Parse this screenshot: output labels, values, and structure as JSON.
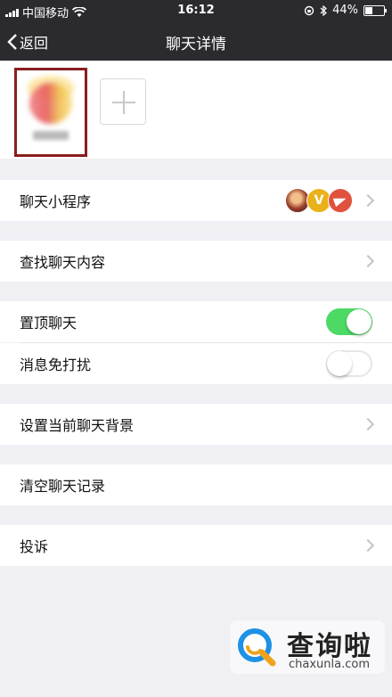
{
  "status_bar": {
    "carrier": "中国移动",
    "time": "16:12",
    "battery": "44%",
    "battery_level": 0.44
  },
  "nav": {
    "back_label": "返回",
    "title": "聊天详情"
  },
  "settings": {
    "mini_programs": "聊天小程序",
    "mini_badge_v": "V",
    "search_chat": "查找聊天内容",
    "sticky_chat": "置顶聊天",
    "sticky_on": true,
    "do_not_disturb": "消息免打扰",
    "dnd_on": false,
    "set_background": "设置当前聊天背景",
    "clear_history": "清空聊天记录",
    "report": "投诉"
  },
  "watermark": {
    "text": "查询啦",
    "url": "chaxunla.com"
  },
  "colors": {
    "nav_bg": "#2b2b2f",
    "page_bg": "#efeff4",
    "toggle_on": "#4cd964",
    "highlight_border": "#8a1e1e"
  }
}
